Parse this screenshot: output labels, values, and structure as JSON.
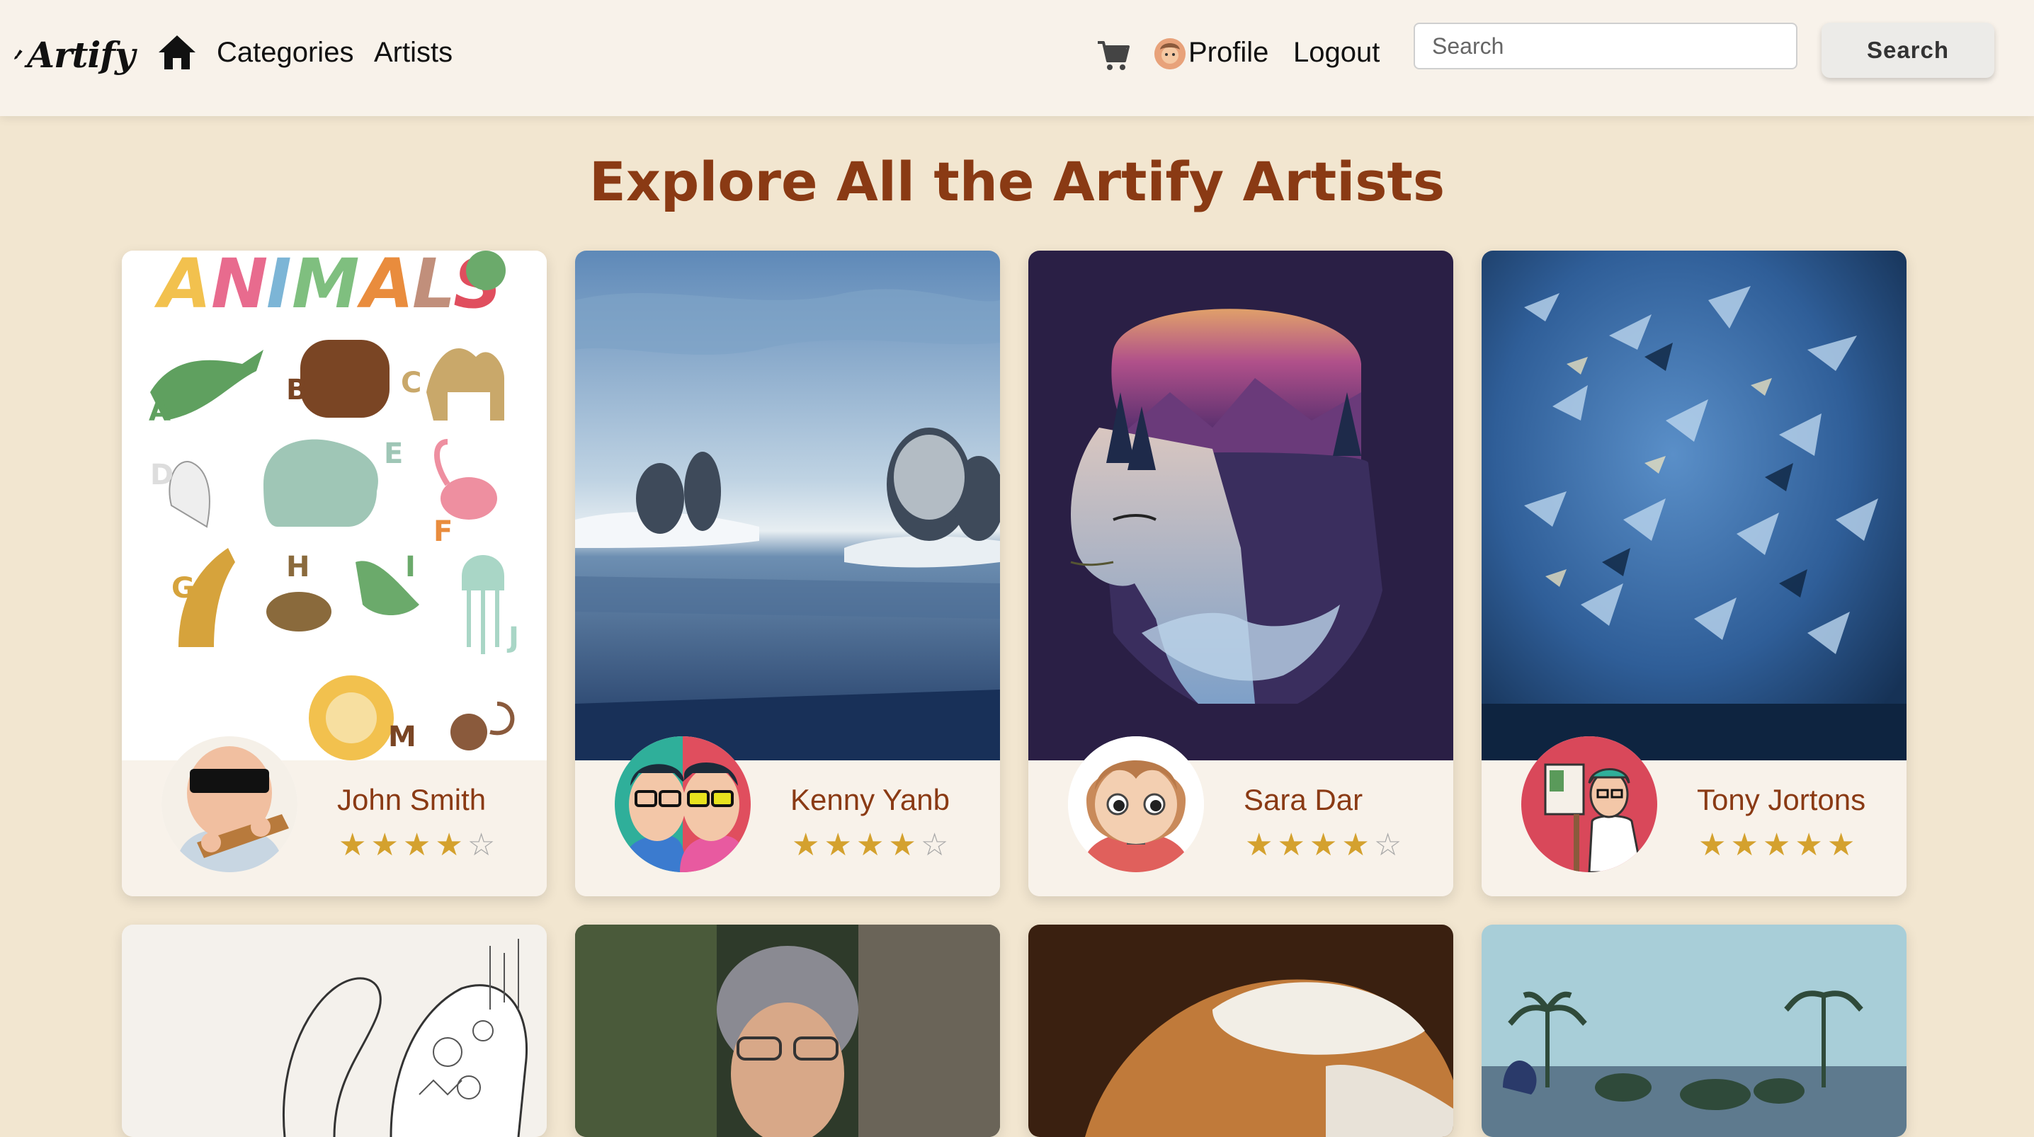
{
  "navbar": {
    "brand": "Artify",
    "links": {
      "categories": "Categories",
      "artists": "Artists",
      "profile": "Profile",
      "logout": "Logout"
    },
    "search": {
      "placeholder": "Search",
      "button_label": "Search"
    }
  },
  "page": {
    "title": "Explore All the Artify Artists"
  },
  "artists": [
    {
      "name": "John Smith",
      "rating": 4,
      "stars": [
        "★",
        "★",
        "★",
        "★",
        "☆"
      ]
    },
    {
      "name": "Kenny Yanb",
      "rating": 4,
      "stars": [
        "★",
        "★",
        "★",
        "★",
        "☆"
      ]
    },
    {
      "name": "Sara Dar",
      "rating": 4,
      "stars": [
        "★",
        "★",
        "★",
        "★",
        "☆"
      ]
    },
    {
      "name": "Tony Jortons",
      "rating": 5,
      "stars": [
        "★",
        "★",
        "★",
        "★",
        "★"
      ]
    }
  ],
  "colors": {
    "accent": "#8A3A14",
    "star": "#D4A12E",
    "background": "#F2E6D0",
    "navbar": "#F8F2EA"
  }
}
